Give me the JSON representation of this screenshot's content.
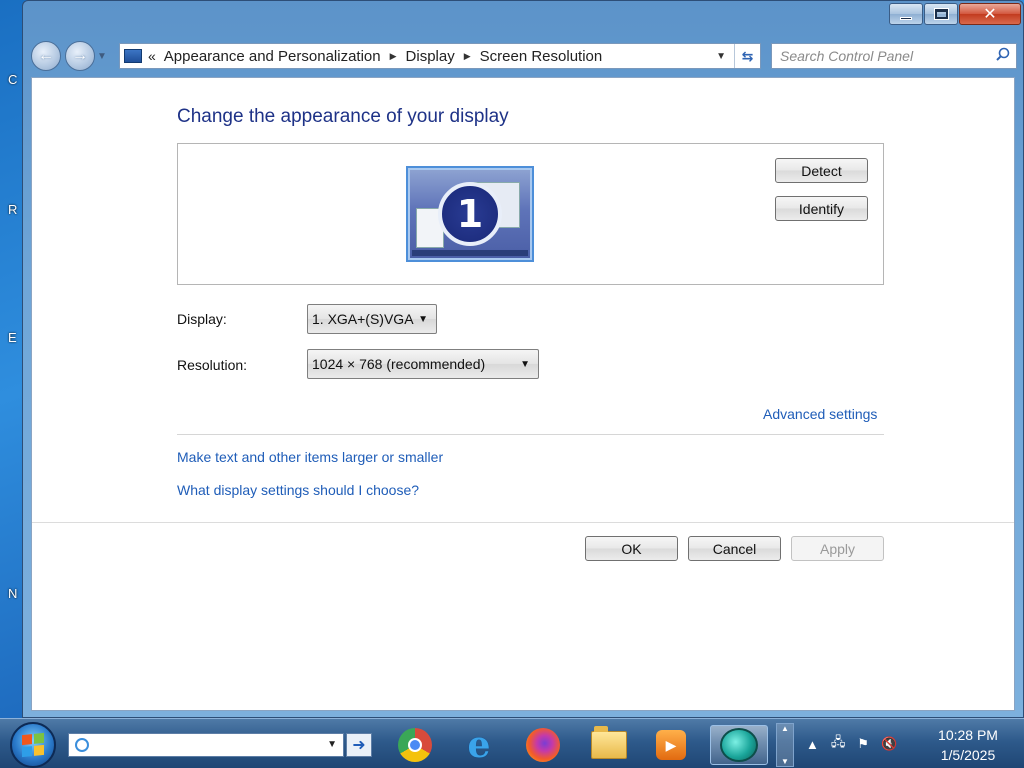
{
  "desktop": {
    "edge_letters": [
      "C",
      "R",
      "E",
      "N"
    ]
  },
  "window": {
    "caption": {
      "minimize": "",
      "maximize": "",
      "close": "✕"
    },
    "nav": {
      "back": "←",
      "forward": "→"
    },
    "breadcrumb": {
      "chevron": "«",
      "items": [
        "Appearance and Personalization",
        "Display",
        "Screen Resolution"
      ]
    },
    "search": {
      "placeholder": "Search Control Panel"
    }
  },
  "main": {
    "heading": "Change the appearance of your display",
    "monitor_number": "1",
    "detect_label": "Detect",
    "identify_label": "Identify",
    "display_label": "Display:",
    "display_value": "1. XGA+(S)VGA",
    "resolution_label": "Resolution:",
    "resolution_value": "1024 × 768 (recommended)",
    "advanced_link": "Advanced settings",
    "links": [
      "Make text and other items larger or smaller",
      "What display settings should I choose?"
    ],
    "ok_label": "OK",
    "cancel_label": "Cancel",
    "apply_label": "Apply"
  },
  "taskbar": {
    "apps": [
      "chrome-icon",
      "internet-explorer-icon",
      "firefox-icon",
      "file-explorer-icon",
      "media-player-icon",
      "control-panel-icon"
    ],
    "clock_time": "10:28 PM",
    "clock_date": "1/5/2025"
  }
}
